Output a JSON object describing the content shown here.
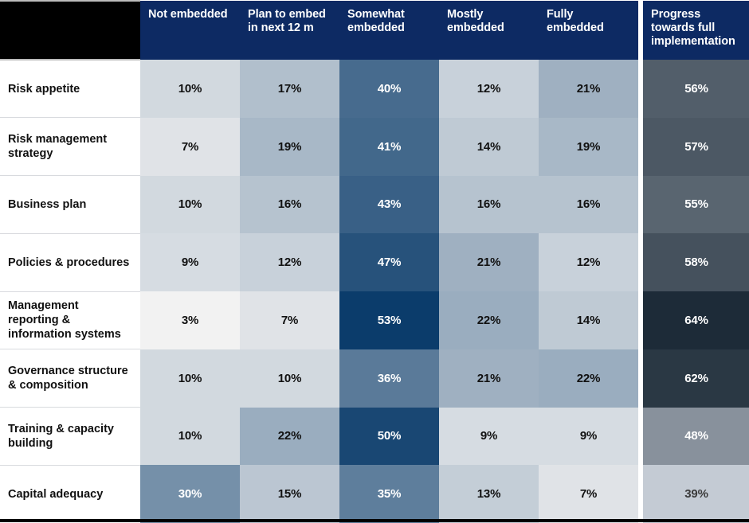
{
  "table": {
    "corner_label": "",
    "columns": [
      "Not embedded",
      "Plan to embed in next 12 m",
      "Somewhat embedded",
      "Mostly embedded",
      "Fully embedded"
    ],
    "columns_lines": [
      [
        "Not embedded"
      ],
      [
        "Plan to embed",
        "in next 12 m"
      ],
      [
        "Somewhat",
        "embedded"
      ],
      [
        "Mostly",
        "embedded"
      ],
      [
        "Fully",
        "embedded"
      ]
    ],
    "progress_column": "Progress towards full implementation",
    "progress_column_lines": [
      "Progress",
      "towards full",
      "implementation"
    ],
    "rows": [
      {
        "label": "Risk appetite",
        "label_lines": [
          "Risk appetite"
        ],
        "values": [
          "10%",
          "17%",
          "40%",
          "12%",
          "21%"
        ],
        "numbers": [
          10,
          17,
          40,
          12,
          21
        ],
        "progress": "56%",
        "progress_number": 56
      },
      {
        "label": "Risk management strategy",
        "label_lines": [
          "Risk management",
          "strategy"
        ],
        "values": [
          "7%",
          "19%",
          "41%",
          "14%",
          "19%"
        ],
        "numbers": [
          7,
          19,
          41,
          14,
          19
        ],
        "progress": "57%",
        "progress_number": 57
      },
      {
        "label": "Business plan",
        "label_lines": [
          "Business plan"
        ],
        "values": [
          "10%",
          "16%",
          "43%",
          "16%",
          "16%"
        ],
        "numbers": [
          10,
          16,
          43,
          16,
          16
        ],
        "progress": "55%",
        "progress_number": 55
      },
      {
        "label": "Policies & procedures",
        "label_lines": [
          "Policies & procedures"
        ],
        "values": [
          "9%",
          "12%",
          "47%",
          "21%",
          "12%"
        ],
        "numbers": [
          9,
          12,
          47,
          21,
          12
        ],
        "progress": "58%",
        "progress_number": 58
      },
      {
        "label": "Management reporting & information systems",
        "label_lines": [
          "Management",
          "reporting &",
          "information systems"
        ],
        "values": [
          "3%",
          "7%",
          "53%",
          "22%",
          "14%"
        ],
        "numbers": [
          3,
          7,
          53,
          22,
          14
        ],
        "progress": "64%",
        "progress_number": 64
      },
      {
        "label": "Governance structure & composition",
        "label_lines": [
          "Governance structure",
          "& composition"
        ],
        "values": [
          "10%",
          "10%",
          "36%",
          "21%",
          "22%"
        ],
        "numbers": [
          10,
          10,
          36,
          21,
          22
        ],
        "progress": "62%",
        "progress_number": 62
      },
      {
        "label": "Training & capacity building",
        "label_lines": [
          "Training & capacity",
          "building"
        ],
        "values": [
          "10%",
          "22%",
          "50%",
          "9%",
          "9%"
        ],
        "numbers": [
          10,
          22,
          50,
          9,
          9
        ],
        "progress": "48%",
        "progress_number": 48
      },
      {
        "label": "Capital adequacy",
        "label_lines": [
          "Capital adequacy"
        ],
        "values": [
          "30%",
          "15%",
          "35%",
          "13%",
          "7%"
        ],
        "numbers": [
          30,
          15,
          35,
          13,
          7
        ],
        "progress": "39%",
        "progress_number": 39
      }
    ]
  },
  "chart_data": {
    "type": "heatmap",
    "title": "",
    "xlabel": "",
    "ylabel": "",
    "categories": [
      "Not embedded",
      "Plan to embed in next 12 m",
      "Somewhat embedded",
      "Mostly embedded",
      "Fully embedded",
      "Progress towards full implementation"
    ],
    "row_labels": [
      "Risk appetite",
      "Risk management strategy",
      "Business plan",
      "Policies & procedures",
      "Management reporting & information systems",
      "Governance structure & composition",
      "Training & capacity building",
      "Capital adequacy"
    ],
    "values": [
      [
        10,
        17,
        40,
        12,
        21,
        56
      ],
      [
        7,
        19,
        41,
        14,
        19,
        57
      ],
      [
        10,
        16,
        43,
        16,
        16,
        55
      ],
      [
        9,
        12,
        47,
        21,
        12,
        58
      ],
      [
        3,
        7,
        53,
        22,
        14,
        64
      ],
      [
        10,
        10,
        36,
        21,
        22,
        62
      ],
      [
        10,
        22,
        50,
        9,
        9,
        48
      ],
      [
        30,
        15,
        35,
        13,
        7,
        39
      ]
    ],
    "unit": "%",
    "grid": false,
    "legend": "none",
    "colorscale_main": [
      "#f2f2f2",
      "#0b3c6b"
    ],
    "colorscale_progress": [
      "#c4cbd4",
      "#1d2b38"
    ],
    "main_value_range": [
      3,
      53
    ],
    "progress_value_range": [
      39,
      64
    ]
  },
  "colors": {
    "header_navy": "#0d2a63",
    "corner_black": "#000000",
    "label_text": "#111111",
    "page_background": "#ffffff",
    "row_divider": "#d8dade"
  }
}
